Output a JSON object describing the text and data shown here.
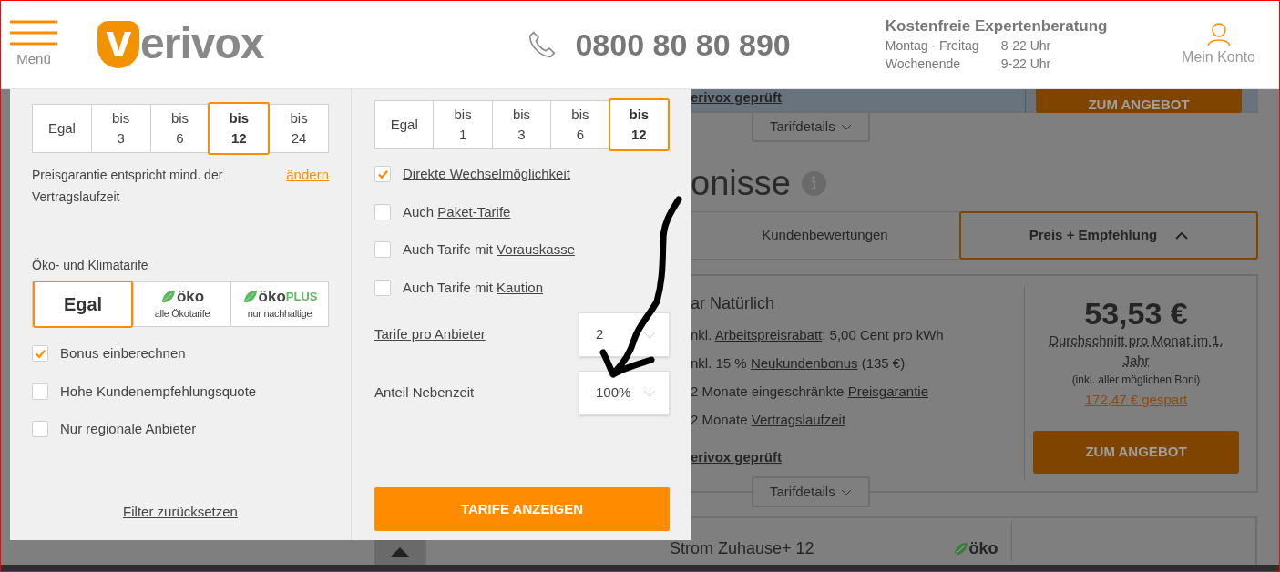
{
  "header": {
    "menu_label": "Menü",
    "logo": {
      "mark": "v",
      "rest": "erivox"
    },
    "phone": "0800 80 80 890",
    "hotline": {
      "title": "Kostenfreie Expertenberatung",
      "hours": [
        {
          "days": "Montag - Freitag",
          "time": "8-22 Uhr"
        },
        {
          "days": "Wochenende",
          "time": "9-22 Uhr"
        }
      ]
    },
    "account_label": "Mein Konto"
  },
  "filter_panel": {
    "left": {
      "duration_options": [
        {
          "line1": "Egal",
          "selected": false
        },
        {
          "line1": "bis",
          "line2": "3",
          "selected": false
        },
        {
          "line1": "bis",
          "line2": "6",
          "selected": false
        },
        {
          "line1": "bis",
          "line2": "12",
          "selected": true
        },
        {
          "line1": "bis",
          "line2": "24",
          "selected": false
        }
      ],
      "guarantee_note": "Preisgarantie entspricht mind. der Vertragslaufzeit",
      "change_link": "ändern",
      "eco_heading": "Öko- und Klimatarife",
      "eco_options": [
        {
          "kind": "text",
          "label": "Egal",
          "selected": true
        },
        {
          "kind": "eco",
          "brand": "öko",
          "caption": "alle Ökotarife",
          "selected": false
        },
        {
          "kind": "ecoplus",
          "brand": "öko",
          "suffix": "PLUS",
          "caption": "nur nachhaltige",
          "selected": false
        }
      ],
      "checkboxes": [
        {
          "label": "Bonus einberechnen",
          "checked": true
        },
        {
          "label": "Hohe Kundenempfehlungsquote",
          "checked": false
        },
        {
          "label": "Nur regionale Anbieter",
          "checked": false
        }
      ],
      "reset_link": "Filter zurücksetzen"
    },
    "right": {
      "guarantee_options": [
        {
          "line1": "Egal",
          "selected": false
        },
        {
          "line1": "bis",
          "line2": "1",
          "selected": false
        },
        {
          "line1": "bis",
          "line2": "3",
          "selected": false
        },
        {
          "line1": "bis",
          "line2": "6",
          "selected": false
        },
        {
          "line1": "bis",
          "line2": "12",
          "selected": true
        }
      ],
      "checkboxes": [
        {
          "link": "Direkte Wechselmöglichkeit",
          "checked": true
        },
        {
          "prefix": "Auch ",
          "link": "Paket-Tarife",
          "checked": false
        },
        {
          "prefix": "Auch Tarife mit ",
          "link": "Vorauskasse",
          "checked": false
        },
        {
          "prefix": "Auch Tarife mit ",
          "link": "Kaution",
          "checked": false
        }
      ],
      "selects": [
        {
          "kind": "link",
          "label": "Tarife pro Anbieter",
          "value": "2"
        },
        {
          "kind": "text",
          "label": "Anteil Nebenzeit",
          "value": "100%"
        }
      ],
      "submit": "TARIFE ANZEIGEN"
    }
  },
  "results": {
    "top_card": {
      "verified": "erivox geprüft",
      "cta": "ZUM ANGEBOT",
      "details": "Tarifdetails"
    },
    "heading": "onisse",
    "tabs": [
      {
        "label": "Kundenbewertungen",
        "selected": false
      },
      {
        "label": "Preis + Empfehlung",
        "selected": true
      }
    ],
    "tariff": {
      "name": "ar Natürlich",
      "features": [
        {
          "before": "nkl. ",
          "link": "Arbeitspreisrabatt",
          "after": ": 5,00 Cent pro kWh"
        },
        {
          "before": "nkl. 15 % ",
          "link": "Neukundenbonus",
          "after": " (135 €)"
        },
        {
          "before": "2 Monate eingeschränkte ",
          "link": "Preisgarantie"
        },
        {
          "before": "2 Monate ",
          "link": "Vertragslaufzeit"
        }
      ],
      "verified": "erivox geprüft",
      "price": "53,53 €",
      "price_note": "Durchschnitt pro Monat im 1. Jahr",
      "bonus_note": "(inkl. aller möglichen Boni)",
      "savings": "172,47 € gespart",
      "cta": "ZUM ANGEBOT",
      "details": "Tarifdetails"
    },
    "next_tariff": {
      "name": "Strom Zuhause+ 12",
      "badge": "öko"
    }
  }
}
